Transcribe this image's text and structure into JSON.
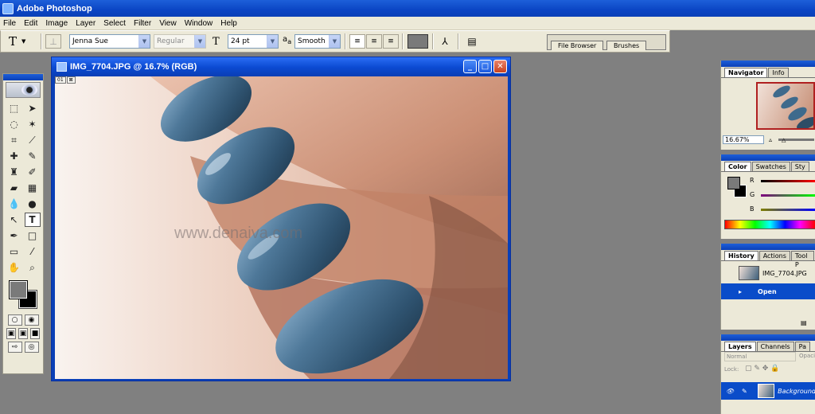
{
  "app": {
    "title": "Adobe Photoshop"
  },
  "menu": [
    "File",
    "Edit",
    "Image",
    "Layer",
    "Select",
    "Filter",
    "View",
    "Window",
    "Help"
  ],
  "options": {
    "font_family": "Jenna Sue",
    "font_style": "Regular",
    "font_size": "24 pt",
    "aa_label": "a",
    "antialias": "Smooth",
    "tabs": [
      "File Browser",
      "Brushes"
    ],
    "text_color": "#7a7a7a"
  },
  "toolbox": {
    "tools": [
      "marquee-icon",
      "move-icon",
      "lasso-icon",
      "magic-wand-icon",
      "crop-icon",
      "slice-icon",
      "healing-icon",
      "brush-icon",
      "stamp-icon",
      "history-brush-icon",
      "eraser-icon",
      "gradient-icon",
      "blur-icon",
      "dodge-icon",
      "path-select-icon",
      "type-icon",
      "pen-icon",
      "shape-icon",
      "notes-icon",
      "eyedropper-icon",
      "hand-icon",
      "zoom-icon"
    ],
    "foreground_color": "#7a7a7a",
    "background_color": "#000000"
  },
  "document": {
    "title": "IMG_7704.JPG @ 16.7% (RGB)",
    "watermark": "www.denaiva.com",
    "badge": [
      "01",
      "⊠"
    ]
  },
  "navigator": {
    "tabs": [
      "Navigator",
      "Info"
    ],
    "zoom": "16.67%"
  },
  "color": {
    "tabs": [
      "Color",
      "Swatches",
      "Sty"
    ],
    "channels": [
      "R",
      "G",
      "B"
    ]
  },
  "history": {
    "tabs": [
      "History",
      "Actions",
      "Tool P"
    ],
    "snapshot": "IMG_7704.JPG",
    "steps": [
      "Open"
    ]
  },
  "layers": {
    "tabs": [
      "Layers",
      "Channels",
      "Pa"
    ],
    "mode": "Normal",
    "opacity_label": "Opaci",
    "lock_label": "Lock:",
    "layer_name": "Background"
  }
}
